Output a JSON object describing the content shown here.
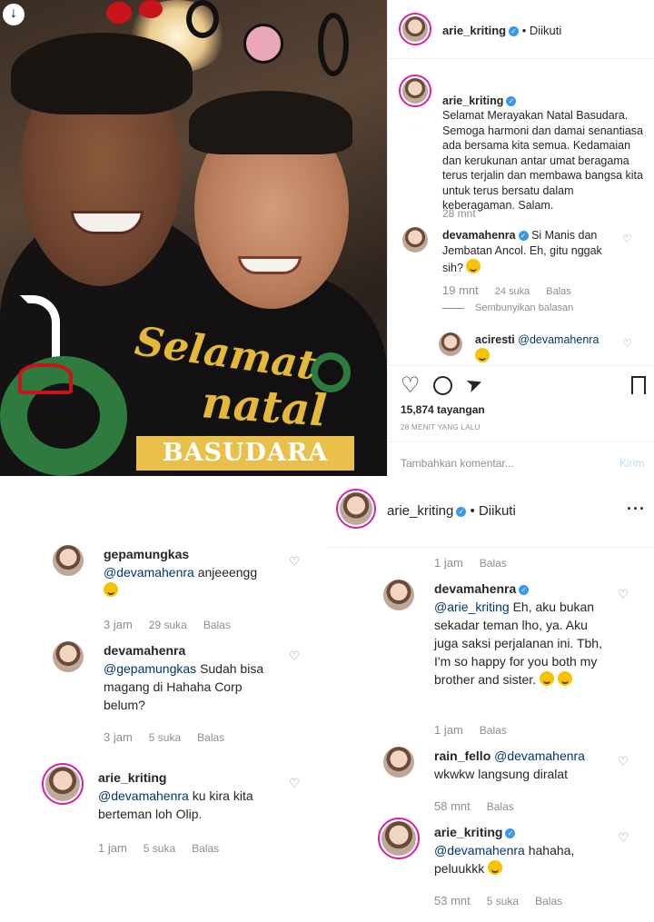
{
  "post": {
    "author": "arie_kriting",
    "follow_status": "• Diikuti",
    "caption": "Selamat Merayakan Natal Basudara.\nSemoga harmoni dan damai senantiasa ada bersama kita semua. Kedamaian dan kerukunan antar umat beragama terus terjalin dan membawa bangsa kita untuk terus bersatu dalam keberagaman. Salam.",
    "caption_time": "28 mnt",
    "sticker_line1": "Selamat",
    "sticker_line2": "natal",
    "sticker_banner": "BASUDARA",
    "views": "15,874 tayangan",
    "posted_ago": "28 MENIT YANG LALU",
    "comment_placeholder": "Tambahkan komentar...",
    "send_label": "Kirim"
  },
  "right_comments": [
    {
      "user": "devamahenra",
      "verified": true,
      "mention": "",
      "text": "Si Manis dan Jembatan Ancol. Eh, gitu nggak sih?",
      "time": "19 mnt",
      "likes": "24 suka",
      "reply": "Balas"
    },
    {
      "hide_replies": "Sembunyikan balasan"
    },
    {
      "user": "aciresti",
      "mention": "@devamahenra",
      "text": ""
    }
  ],
  "left_comments": [
    {
      "user": "gepamungkas",
      "mention": "@devamahenra",
      "text": "anjeeengg",
      "time": "3 jam",
      "likes": "29 suka",
      "reply": "Balas"
    },
    {
      "user": "devamahenra",
      "mention": "@gepamungkas",
      "text": "Sudah bisa magang di Hahaha Corp belum?",
      "time": "3 jam",
      "likes": "5 suka",
      "reply": "Balas"
    },
    {
      "user": "arie_kriting",
      "mention": "@devamahenra",
      "text": "ku kira kita berteman loh Olip.",
      "time": "1 jam",
      "likes": "5 suka",
      "reply": "Balas"
    }
  ],
  "right_panel": {
    "author": "arie_kriting",
    "follow_status": "• Diikuti",
    "top_time": "1 jam",
    "top_reply": "Balas",
    "comments": [
      {
        "user": "devamahenra",
        "mention": "@arie_kriting",
        "text": "Eh, aku bukan sekadar teman lho, ya. Aku juga saksi perjalanan ini. Tbh, I'm so happy for you both my brother and sister.",
        "time": "1 jam",
        "reply": "Balas"
      },
      {
        "user": "rain_fello",
        "mention": "@devamahenra",
        "text": "wkwkw langsung diralat",
        "time": "58 mnt",
        "reply": "Balas"
      },
      {
        "user": "arie_kriting",
        "mention": "@devamahenra",
        "text": "hahaha, peluukkk",
        "time": "53 mnt",
        "likes": "5 suka",
        "reply": "Balas"
      }
    ]
  },
  "colors": {
    "accent": "#3897f0",
    "link": "#00376b",
    "meta": "#8e8e8e"
  }
}
